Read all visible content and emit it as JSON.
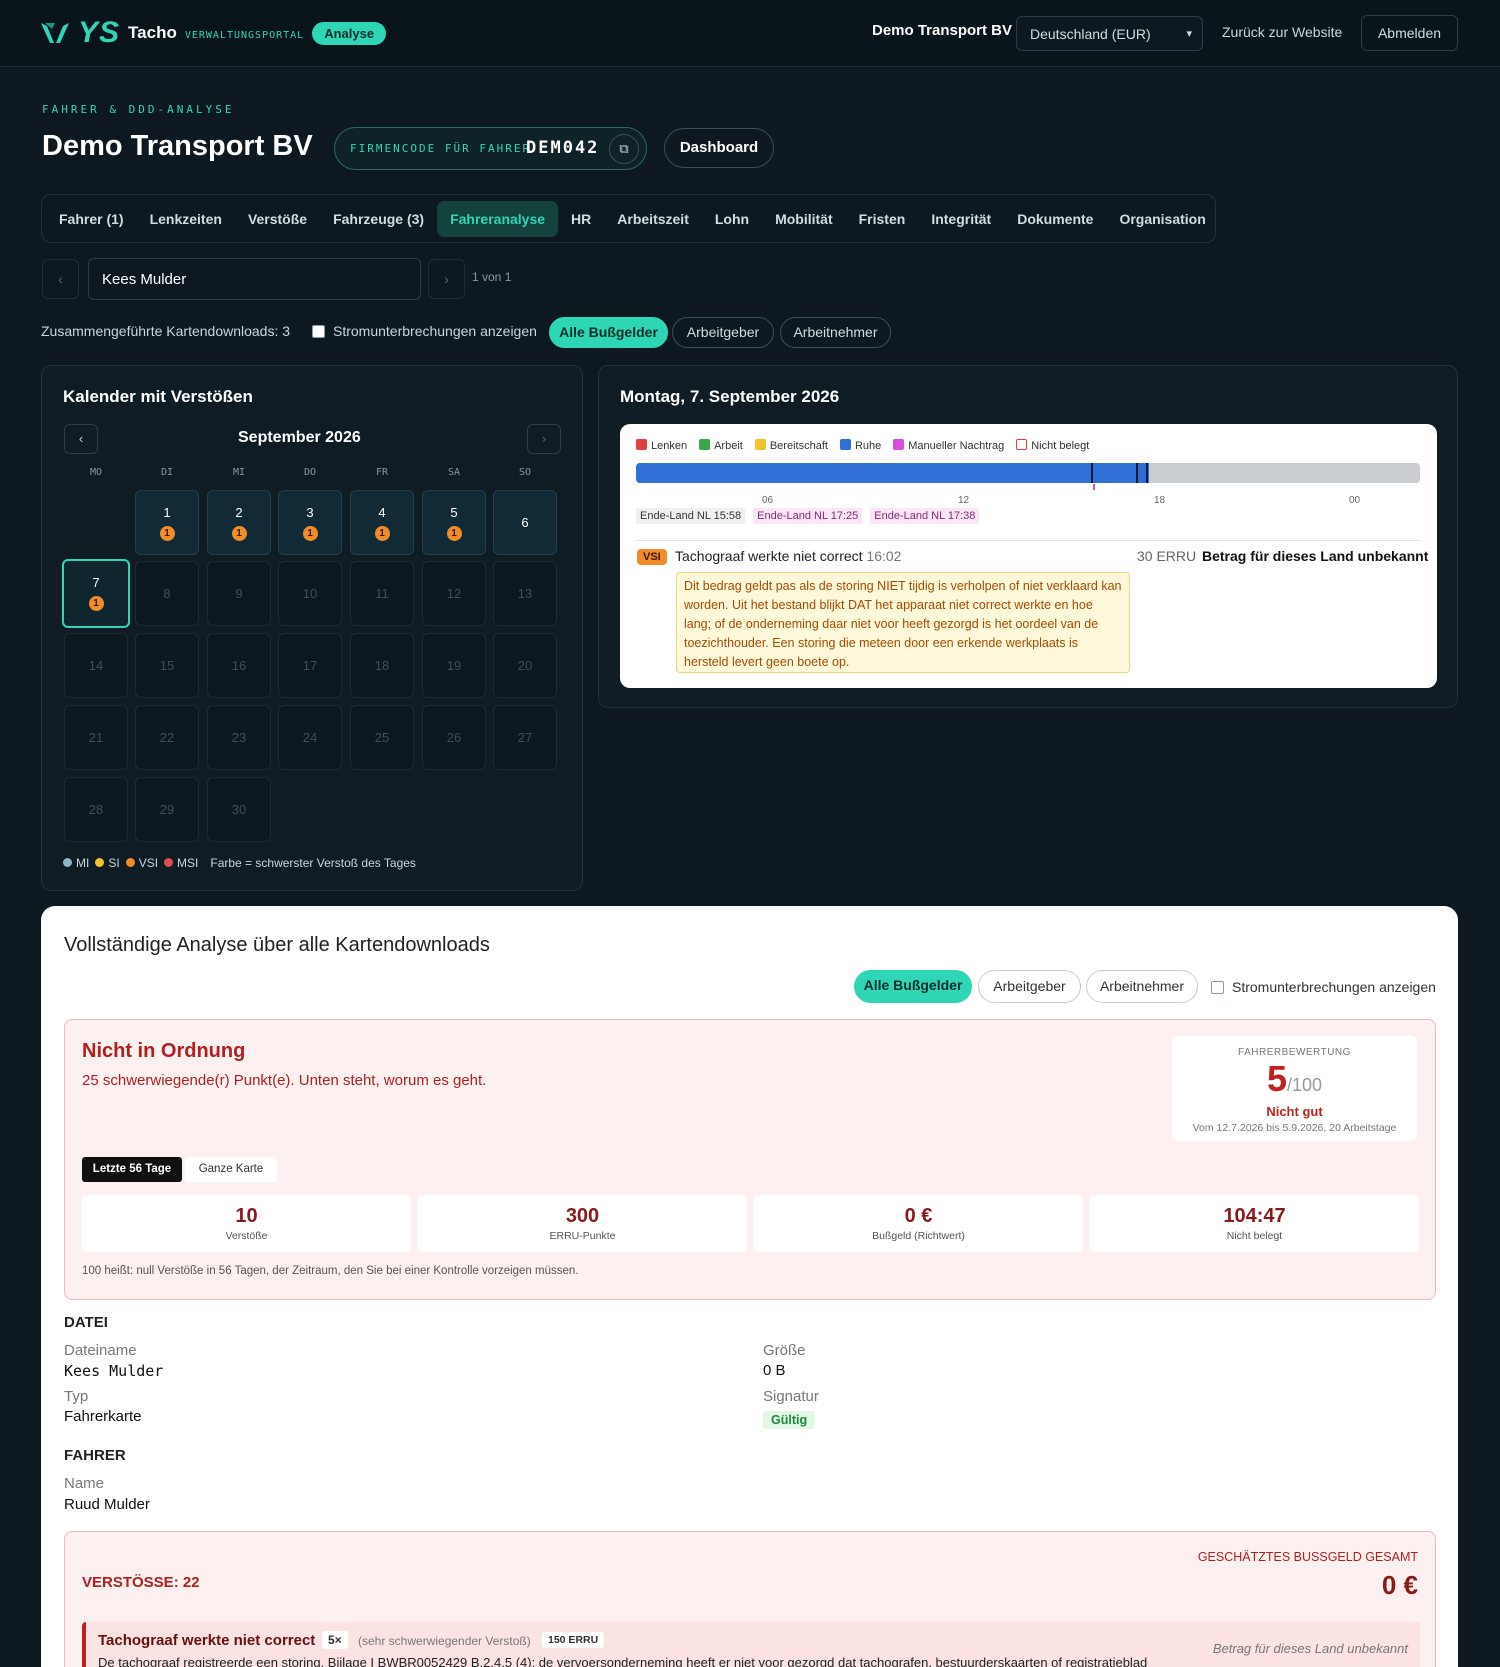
{
  "topbar": {
    "logo": "YS",
    "app_name": "Tacho",
    "app_sub": "VERWALTUNGSPORTAL",
    "badge": "Analyse",
    "company": "Demo Transport BV",
    "country_select": "Deutschland (EUR)",
    "back_link": "Zurück zur Website",
    "logout": "Abmelden"
  },
  "header": {
    "eyebrow": "FAHRER & DDD-ANALYSE",
    "title": "Demo Transport BV",
    "code_label": "FIRMENCODE FÜR FAHRER",
    "code_value": "DEM042",
    "dashboard": "Dashboard"
  },
  "tabs": [
    "Fahrer (1)",
    "Lenkzeiten",
    "Verstöße",
    "Fahrzeuge (3)",
    "Fahreranalyse",
    "HR",
    "Arbeitszeit",
    "Lohn",
    "Mobilität",
    "Fristen",
    "Integrität",
    "Dokumente",
    "Organisation"
  ],
  "active_tab": "Fahreranalyse",
  "driver": {
    "selected": "Kees Mulder",
    "pager": "1 von 1",
    "prev": "‹",
    "next": "›"
  },
  "filters": {
    "merged": "Zusammengeführte Kartendownloads: 3",
    "power": "Stromunterbrechungen anzeigen",
    "all_fines": "Alle Bußgelder",
    "employer": "Arbeitgeber",
    "employee": "Arbeitnehmer"
  },
  "calendar": {
    "title": "Kalender mit Verstößen",
    "month": "September 2026",
    "prev": "‹",
    "next": "›",
    "weekdays": [
      "MO",
      "DI",
      "MI",
      "DO",
      "FR",
      "SA",
      "SO"
    ],
    "legend": {
      "mi": "MI",
      "si": "SI",
      "vsi": "VSI",
      "msi": "MSI",
      "note": "Farbe = schwerster Verstoß des Tages"
    },
    "legend_colors": {
      "mi": "#8fb3c8",
      "si": "#f2c230",
      "vsi": "#f08c2a",
      "msi": "#e05050"
    },
    "badge_count": "1"
  },
  "day_detail": {
    "title": "Montag, 7. September 2026",
    "legend": [
      "Lenken",
      "Arbeit",
      "Bereitschaft",
      "Ruhe",
      "Manueller Nachtrag",
      "Nicht belegt"
    ],
    "legend_colors": [
      "#e04040",
      "#3aa84a",
      "#f2c230",
      "#2f6fd6",
      "#d94fd9",
      "#ffffff"
    ],
    "ticks": [
      "06",
      "12",
      "18",
      "00"
    ],
    "flags": [
      "Ende-Land NL 15:58",
      "Ende-Land NL 17:25",
      "Ende-Land NL 17:38"
    ],
    "violation": {
      "level": "VSI",
      "title": "Tachograaf werkte niet correct",
      "time": "16:02",
      "erru": "30 ERRU",
      "amount": "Betrag für dieses Land unbekannt",
      "note": "Dit bedrag geldt pas als de storing NIET tijdig is verholpen of niet verklaard kan worden. Uit het bestand blijkt DAT het apparaat niet correct werkte en hoe lang; of de onderneming daar niet voor heeft gezorgd is het oordeel van de toezichthouder. Een storing die meteen door een erkende werkplaats is hersteld levert geen boete op."
    }
  },
  "analysis": {
    "title": "Vollständige Analyse über alle Kartendownloads",
    "all_fines": "Alle Bußgelder",
    "employer": "Arbeitgeber",
    "employee": "Arbeitnehmer",
    "power": "Stromunterbrechungen anzeigen",
    "status": "Nicht in Ordnung",
    "status_sub": "25 schwerwiegende(r) Punkt(e). Unten steht, worum es geht.",
    "score_label": "FAHRERBEWERTUNG",
    "score": "5",
    "score_max": "/100",
    "score_quality": "Nicht gut",
    "score_range": "Vom 12.7.2026 bis 5.9.2026, 20 Arbeitstage",
    "seg_last": "Letzte 56 Tage",
    "seg_all": "Ganze Karte",
    "stats": [
      {
        "value": "10",
        "label": "Verstöße"
      },
      {
        "value": "300",
        "label": "ERRU-Punkte"
      },
      {
        "value": "0 €",
        "label": "Bußgeld (Richtwert)"
      },
      {
        "value": "104:47",
        "label": "Nicht belegt"
      }
    ],
    "hint": "100 heißt: null Verstöße in 56 Tagen, der Zeitraum, den Sie bei einer Kontrolle vorzeigen müssen.",
    "file_section": "DATEI",
    "file_name_label": "Dateiname",
    "file_name": "Kees Mulder",
    "type_label": "Typ",
    "type": "Fahrerkarte",
    "size_label": "Größe",
    "size": "0 B",
    "sig_label": "Signatur",
    "sig": "Gültig",
    "driver_section": "FAHRER",
    "name_label": "Name",
    "name": "Ruud Mulder",
    "violations_count": "VERSTÖSSE: 22",
    "est_label": "GESCHÄTZTES BUSSGELD GESAMT",
    "est_value": "0 €",
    "item": {
      "title": "Tachograaf werkte niet correct",
      "times": "5×",
      "severity": "(sehr schwerwiegender Verstoß)",
      "erru": "150 ERRU",
      "right": "Betrag für dieses Land unbekannt",
      "desc": "De tachograaf registreerde een storing. Bijlage I BWBR0052429 B.2.4.5 (4): de vervoersonderneming heeft er niet voor gezorgd dat tachografen, bestuurderskaarten of registratiebladen"
    }
  }
}
